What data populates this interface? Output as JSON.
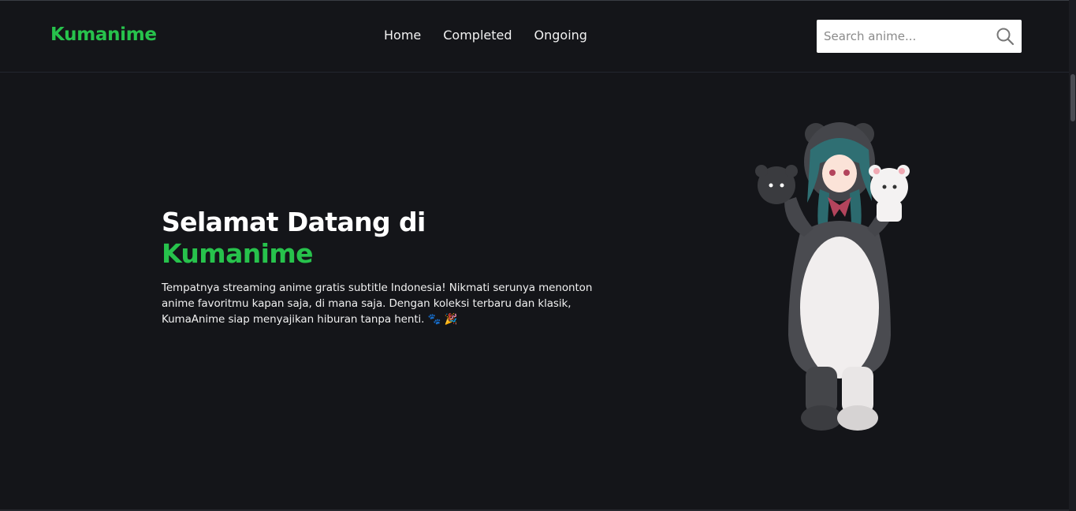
{
  "brand": {
    "name": "Kumanime",
    "accent_color": "#27c24c"
  },
  "nav": {
    "items": [
      {
        "label": "Home"
      },
      {
        "label": "Completed"
      },
      {
        "label": "Ongoing"
      }
    ]
  },
  "search": {
    "placeholder": "Search anime...",
    "value": "",
    "icon": "search-icon"
  },
  "hero": {
    "title_line1": "Selamat Datang di",
    "title_line2": "Kumanime",
    "description": "Tempatnya streaming anime gratis subtitle Indonesia! Nikmati serunya menonton anime favoritmu kapan saja, di mana saja. Dengan koleksi terbaru dan klasik, KumaAnime siap menyajikan hiburan tanpa henti. 🐾 🎉",
    "image": "anime-girl-bear-costume"
  }
}
